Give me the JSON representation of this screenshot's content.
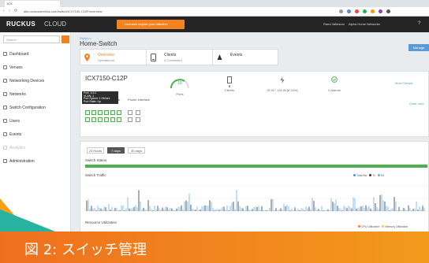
{
  "browser": {
    "tab_title": "ICX",
    "url": "alto.ruckuswireless.com/switch/ICX7150-C12P/overview",
    "nav_back": "‹",
    "nav_forward": "›",
    "nav_reload": "⟳"
  },
  "header": {
    "logo": "RUCKUS",
    "cloud": "CLOUD",
    "license_banner": "Licenses require your attention",
    "user": "Raed Valleseal",
    "networks": "Alpha Home Networks",
    "help": "?"
  },
  "sidebar": {
    "search_placeholder": "Search",
    "items": [
      {
        "label": "Dashboard",
        "icon": "dashboard-icon"
      },
      {
        "label": "Venues",
        "icon": "venue-icon"
      },
      {
        "label": "Networking Devices",
        "icon": "network-icon"
      },
      {
        "label": "Networks",
        "icon": "wifi-icon"
      },
      {
        "label": "Switch Configuration",
        "icon": "switch-icon"
      },
      {
        "label": "Users",
        "icon": "user-icon"
      },
      {
        "label": "Events",
        "icon": "event-icon"
      },
      {
        "label": "Analytics",
        "icon": "chart-icon"
      },
      {
        "label": "Administration",
        "icon": "admin-icon"
      }
    ]
  },
  "main": {
    "breadcrumb": "Switch >",
    "page_title": "Home-Switch",
    "manage_button": "Manage",
    "tabs": [
      {
        "label": "Overview",
        "sub": "Operational",
        "icon": "location-pin-icon",
        "color": "#f58220"
      },
      {
        "label": "Clients",
        "sub": "4 Connected",
        "icon": "device-icon",
        "color": "#555555"
      },
      {
        "label": "Events",
        "sub": "",
        "icon": "event-icon",
        "color": "#555555"
      }
    ],
    "device": {
      "model": "ICX7150-C12P",
      "ports_value": "15",
      "ports_label": "Ports",
      "clients_value": "6",
      "clients_label": "Clients",
      "power_value": "25 W / 124 W (8.23%)",
      "alarms_label": "0 Alarms",
      "more_details": "More Details",
      "subtabs": [
        "Front",
        "Rear",
        "Power Interface"
      ],
      "clear_view": "Clear view",
      "tooltip_lines": [
        "Port: 1/1/1",
        "VLAN: 1",
        "Port Speed: 1 Gb/sec",
        "Port State: Up"
      ]
    },
    "traffic": {
      "ranges": [
        "24 Hours",
        "7 days",
        "30 days"
      ],
      "selected_range": "7 days",
      "switch_status": "Switch Status",
      "switch_traffic": "Switch Traffic",
      "legend": [
        "Total Bw",
        "Tx",
        "Rx"
      ],
      "legend_colors": [
        "#4a90d9",
        "#333333",
        "#6ab0e8"
      ],
      "resource_utilization": "Resource Utilization",
      "resource_legend": [
        "CPU Utilization",
        "Memory Utilization"
      ],
      "resource_colors": [
        "#f58220",
        "#f6c644"
      ],
      "status_color": "#4caf50"
    }
  },
  "caption": "図 2: スイッチ管理"
}
